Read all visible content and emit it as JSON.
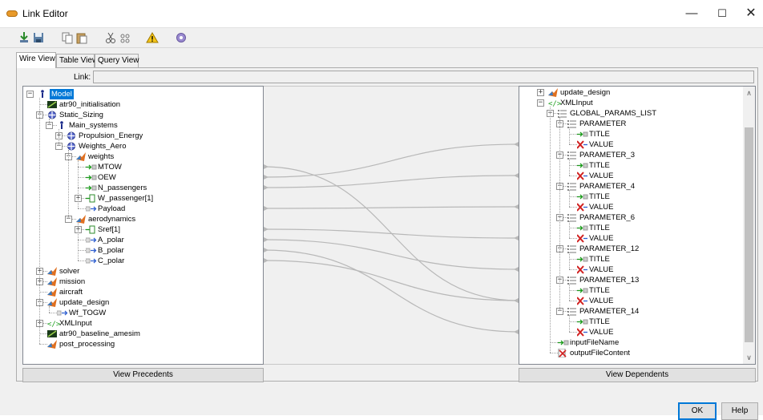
{
  "window": {
    "title": "Link Editor",
    "minimize": "—",
    "maximize": "☐",
    "close": "✕"
  },
  "toolbar": {
    "items": [
      "import-icon",
      "save-icon",
      "copy-icon",
      "paste-icon",
      "cut-icon",
      "link-icon",
      "warning-icon",
      "settings-icon"
    ]
  },
  "tabs": [
    {
      "label": "Wire View",
      "active": true
    },
    {
      "label": "Table View",
      "active": false
    },
    {
      "label": "Query View",
      "active": false
    }
  ],
  "link": {
    "label": "Link:",
    "value": ""
  },
  "left_tree": [
    {
      "label": "Model",
      "depth": 0,
      "icon": "model-icon",
      "exp": "minus",
      "selected": true
    },
    {
      "label": "atr90_initialisation",
      "depth": 1,
      "icon": "amesim-icon",
      "exp": ""
    },
    {
      "label": "Static_Sizing",
      "depth": 1,
      "icon": "assembly-icon",
      "exp": "minus"
    },
    {
      "label": "Main_systems",
      "depth": 2,
      "icon": "model-icon",
      "exp": "minus"
    },
    {
      "label": "Propulsion_Energy",
      "depth": 3,
      "icon": "assembly-icon",
      "exp": "plus"
    },
    {
      "label": "Weights_Aero",
      "depth": 3,
      "icon": "assembly-icon",
      "exp": "minus"
    },
    {
      "label": "weights",
      "depth": 4,
      "icon": "matlab-icon",
      "exp": "minus"
    },
    {
      "label": "MTOW",
      "depth": 5,
      "icon": "input-var-icon",
      "exp": ""
    },
    {
      "label": "OEW",
      "depth": 5,
      "icon": "input-var-icon",
      "exp": ""
    },
    {
      "label": "N_passengers",
      "depth": 5,
      "icon": "input-var-icon",
      "exp": ""
    },
    {
      "label": "W_passenger[1]",
      "depth": 5,
      "icon": "array-icon",
      "exp": "plus"
    },
    {
      "label": "Payload",
      "depth": 5,
      "icon": "output-var-icon",
      "exp": ""
    },
    {
      "label": "aerodynamics",
      "depth": 4,
      "icon": "matlab-icon",
      "exp": "minus"
    },
    {
      "label": "Sref[1]",
      "depth": 5,
      "icon": "array-icon",
      "exp": "plus"
    },
    {
      "label": "A_polar",
      "depth": 5,
      "icon": "output-var-icon",
      "exp": ""
    },
    {
      "label": "B_polar",
      "depth": 5,
      "icon": "output-var-icon",
      "exp": ""
    },
    {
      "label": "C_polar",
      "depth": 5,
      "icon": "output-var-icon",
      "exp": ""
    },
    {
      "label": "solver",
      "depth": 1,
      "icon": "matlab-icon",
      "exp": "plus"
    },
    {
      "label": "mission",
      "depth": 1,
      "icon": "matlab-icon",
      "exp": "plus"
    },
    {
      "label": "aircraft",
      "depth": 1,
      "icon": "matlab-icon",
      "exp": ""
    },
    {
      "label": "update_design",
      "depth": 1,
      "icon": "matlab-icon",
      "exp": "minus"
    },
    {
      "label": "Wf_TOGW",
      "depth": 2,
      "icon": "output-var-icon",
      "exp": ""
    },
    {
      "label": "XMLInput",
      "depth": 1,
      "icon": "xml-icon",
      "exp": "plus"
    },
    {
      "label": "atr90_baseline_amesim",
      "depth": 1,
      "icon": "amesim-icon",
      "exp": ""
    },
    {
      "label": "post_processing",
      "depth": 1,
      "icon": "matlab-icon",
      "exp": ""
    }
  ],
  "right_tree": [
    {
      "label": "update_design",
      "depth": 0,
      "icon": "matlab-icon",
      "exp": "plus"
    },
    {
      "label": "XMLInput",
      "depth": 0,
      "icon": "xml-icon",
      "exp": "minus"
    },
    {
      "label": "GLOBAL_PARAMS_LIST",
      "depth": 1,
      "icon": "list-icon",
      "exp": "minus"
    },
    {
      "label": "PARAMETER",
      "depth": 2,
      "icon": "list-icon",
      "exp": "minus"
    },
    {
      "label": "TITLE",
      "depth": 3,
      "icon": "input-var-icon",
      "exp": ""
    },
    {
      "label": "VALUE",
      "depth": 3,
      "icon": "xml-value-icon",
      "exp": ""
    },
    {
      "label": "PARAMETER_3",
      "depth": 2,
      "icon": "list-icon",
      "exp": "minus"
    },
    {
      "label": "TITLE",
      "depth": 3,
      "icon": "input-var-icon",
      "exp": ""
    },
    {
      "label": "VALUE",
      "depth": 3,
      "icon": "xml-value-icon",
      "exp": ""
    },
    {
      "label": "PARAMETER_4",
      "depth": 2,
      "icon": "list-icon",
      "exp": "minus"
    },
    {
      "label": "TITLE",
      "depth": 3,
      "icon": "input-var-icon",
      "exp": ""
    },
    {
      "label": "VALUE",
      "depth": 3,
      "icon": "xml-value-icon",
      "exp": ""
    },
    {
      "label": "PARAMETER_6",
      "depth": 2,
      "icon": "list-icon",
      "exp": "minus"
    },
    {
      "label": "TITLE",
      "depth": 3,
      "icon": "input-var-icon",
      "exp": ""
    },
    {
      "label": "VALUE",
      "depth": 3,
      "icon": "xml-value-icon",
      "exp": ""
    },
    {
      "label": "PARAMETER_12",
      "depth": 2,
      "icon": "list-icon",
      "exp": "minus"
    },
    {
      "label": "TITLE",
      "depth": 3,
      "icon": "input-var-icon",
      "exp": ""
    },
    {
      "label": "VALUE",
      "depth": 3,
      "icon": "xml-value-icon",
      "exp": ""
    },
    {
      "label": "PARAMETER_13",
      "depth": 2,
      "icon": "list-icon",
      "exp": "minus"
    },
    {
      "label": "TITLE",
      "depth": 3,
      "icon": "input-var-icon",
      "exp": ""
    },
    {
      "label": "VALUE",
      "depth": 3,
      "icon": "xml-value-icon",
      "exp": ""
    },
    {
      "label": "PARAMETER_14",
      "depth": 2,
      "icon": "list-icon",
      "exp": "minus"
    },
    {
      "label": "TITLE",
      "depth": 3,
      "icon": "input-var-icon",
      "exp": ""
    },
    {
      "label": "VALUE",
      "depth": 3,
      "icon": "xml-value-icon",
      "exp": ""
    },
    {
      "label": "inputFileName",
      "depth": 1,
      "icon": "input-var-icon",
      "exp": ""
    },
    {
      "label": "outputFileContent",
      "depth": 1,
      "icon": "file-content-icon",
      "exp": ""
    }
  ],
  "links": [
    {
      "from": "MTOW",
      "to": "PARAMETER_13 / VALUE"
    },
    {
      "from": "OEW",
      "to": "VALUE"
    },
    {
      "from": "N_passengers",
      "to": "PARAMETER_3 / VALUE"
    },
    {
      "from": "Payload",
      "to": "PARAMETER_4 / VALUE"
    },
    {
      "from": "Sref[1]",
      "to": "PARAMETER_6 / VALUE"
    },
    {
      "from": "A_polar",
      "to": "PARAMETER_12 / VALUE"
    },
    {
      "from": "B_polar",
      "to": "PARAMETER_14 / VALUE"
    },
    {
      "from": "C_polar",
      "to": "PARAMETER_13 / VALUE"
    }
  ],
  "buttons": {
    "view_precedents": "View Precedents",
    "view_dependents": "View Dependents",
    "ok": "OK",
    "help": "Help"
  },
  "colors": {
    "selection": "#0078d7",
    "matlab": "#e07020",
    "input_arrow": "#1a9a1a",
    "output_arrow": "#3060d0",
    "xml": "#20a020",
    "value_x": "#d02020",
    "wire": "#b8b8b8"
  }
}
